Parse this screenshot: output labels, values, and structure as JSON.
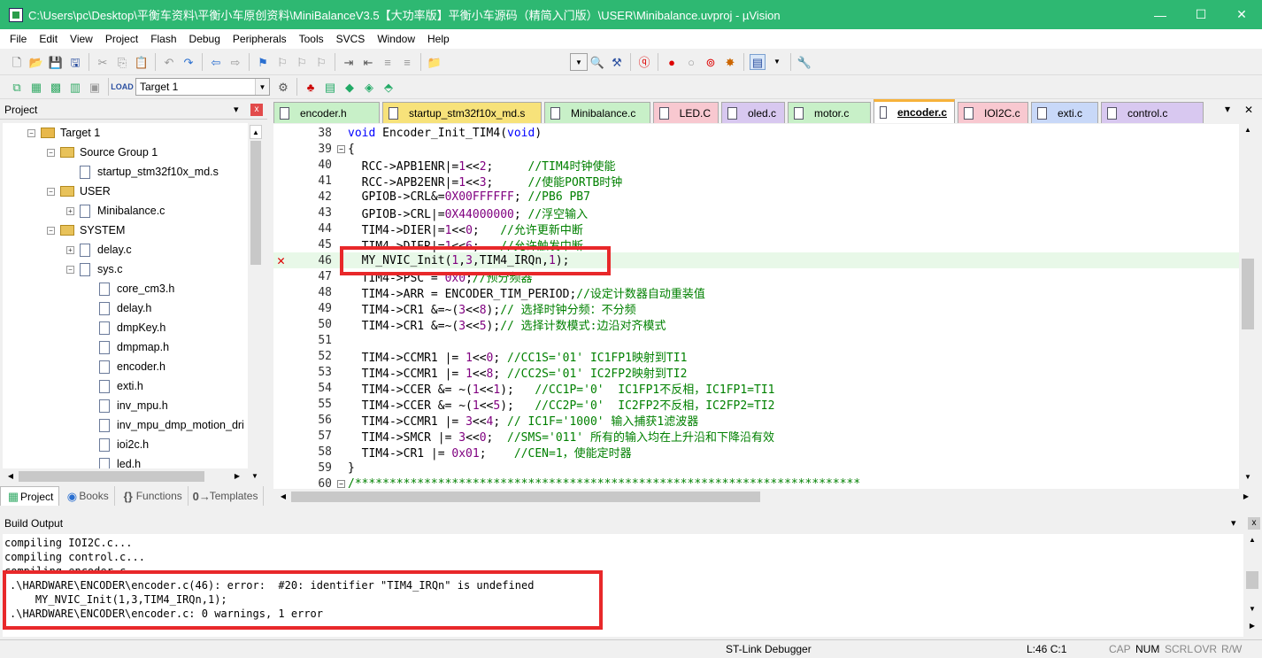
{
  "window": {
    "title": "C:\\Users\\pc\\Desktop\\平衡车资料\\平衡小车原创资料\\MiniBalanceV3.5【大功率版】平衡小车源码（精简入门版）\\USER\\Minibalance.uvproj - µVision",
    "min": "—",
    "max": "☐",
    "close": "✕"
  },
  "menu": [
    "File",
    "Edit",
    "View",
    "Project",
    "Flash",
    "Debug",
    "Peripherals",
    "Tools",
    "SVCS",
    "Window",
    "Help"
  ],
  "toolbar2": {
    "target": "Target 1"
  },
  "project": {
    "title": "Project",
    "pin": "▾",
    "close": "x",
    "tree": [
      {
        "label": "Target 1",
        "type": "target",
        "indent": 0,
        "pm": "−"
      },
      {
        "label": "Source Group 1",
        "type": "folder",
        "indent": 1,
        "pm": "−"
      },
      {
        "label": "startup_stm32f10x_md.s",
        "type": "file",
        "indent": 2,
        "pm": ""
      },
      {
        "label": "USER",
        "type": "folder",
        "indent": 1,
        "pm": "−"
      },
      {
        "label": "Minibalance.c",
        "type": "file",
        "indent": 2,
        "pm": "+"
      },
      {
        "label": "SYSTEM",
        "type": "folder",
        "indent": 1,
        "pm": "−"
      },
      {
        "label": "delay.c",
        "type": "file",
        "indent": 2,
        "pm": "+"
      },
      {
        "label": "sys.c",
        "type": "file",
        "indent": 2,
        "pm": "−"
      },
      {
        "label": "core_cm3.h",
        "type": "file",
        "indent": 3,
        "pm": ""
      },
      {
        "label": "delay.h",
        "type": "file",
        "indent": 3,
        "pm": ""
      },
      {
        "label": "dmpKey.h",
        "type": "file",
        "indent": 3,
        "pm": ""
      },
      {
        "label": "dmpmap.h",
        "type": "file",
        "indent": 3,
        "pm": ""
      },
      {
        "label": "encoder.h",
        "type": "file",
        "indent": 3,
        "pm": ""
      },
      {
        "label": "exti.h",
        "type": "file",
        "indent": 3,
        "pm": ""
      },
      {
        "label": "inv_mpu.h",
        "type": "file",
        "indent": 3,
        "pm": ""
      },
      {
        "label": "inv_mpu_dmp_motion_dri",
        "type": "file",
        "indent": 3,
        "pm": ""
      },
      {
        "label": "ioi2c.h",
        "type": "file",
        "indent": 3,
        "pm": ""
      },
      {
        "label": "led.h",
        "type": "file",
        "indent": 3,
        "pm": ""
      }
    ],
    "tabs": [
      "Project",
      "Books",
      "Functions",
      "Templates"
    ]
  },
  "filetabs": [
    {
      "label": "encoder.h",
      "color": "#c8f0c8",
      "active": false
    },
    {
      "label": "startup_stm32f10x_md.s",
      "color": "#f7e27a",
      "active": false
    },
    {
      "label": "Minibalance.c",
      "color": "#c8f0c8",
      "active": false
    },
    {
      "label": "LED.C",
      "color": "#f8c8d0",
      "active": false
    },
    {
      "label": "oled.c",
      "color": "#d8c8f0",
      "active": false
    },
    {
      "label": "motor.c",
      "color": "#c8f0c8",
      "active": false
    },
    {
      "label": "encoder.c",
      "color": "#f7d07a",
      "active": true
    },
    {
      "label": "IOI2C.c",
      "color": "#f8c8d0",
      "active": false
    },
    {
      "label": "exti.c",
      "color": "#c8d8f8",
      "active": false
    },
    {
      "label": "control.c",
      "color": "#d8c8f0",
      "active": false
    }
  ],
  "tabmenu": "▾",
  "tabclose": "✕",
  "code": [
    {
      "n": "38",
      "t": "void Encoder_Init_TIM4(void)"
    },
    {
      "n": "39",
      "t": "{"
    },
    {
      "n": "40",
      "t": "  RCC->APB1ENR|=1<<2;     //TIM4时钟使能"
    },
    {
      "n": "41",
      "t": "  RCC->APB2ENR|=1<<3;     //使能PORTB时钟"
    },
    {
      "n": "42",
      "t": "  GPIOB->CRL&=0X00FFFFFF; //PB6 PB7"
    },
    {
      "n": "43",
      "t": "  GPIOB->CRL|=0X44000000; //浮空输入"
    },
    {
      "n": "44",
      "t": "  TIM4->DIER|=1<<0;   //允许更新中断"
    },
    {
      "n": "45",
      "t": "  TIM4->DIER|=1<<6;   //允许触发中断"
    },
    {
      "n": "46",
      "t": "  MY_NVIC_Init(1,3,TIM4_IRQn,1);"
    },
    {
      "n": "47",
      "t": "  TIM4->PSC = 0x0;//预分频器"
    },
    {
      "n": "48",
      "t": "  TIM4->ARR = ENCODER_TIM_PERIOD;//设定计数器自动重装值"
    },
    {
      "n": "49",
      "t": "  TIM4->CR1 &=~(3<<8);// 选择时钟分频：不分频"
    },
    {
      "n": "50",
      "t": "  TIM4->CR1 &=~(3<<5);// 选择计数模式:边沿对齐模式"
    },
    {
      "n": "51",
      "t": ""
    },
    {
      "n": "52",
      "t": "  TIM4->CCMR1 |= 1<<0; //CC1S='01' IC1FP1映射到TI1"
    },
    {
      "n": "53",
      "t": "  TIM4->CCMR1 |= 1<<8; //CC2S='01' IC2FP2映射到TI2"
    },
    {
      "n": "54",
      "t": "  TIM4->CCER &= ~(1<<1);   //CC1P='0'  IC1FP1不反相，IC1FP1=TI1"
    },
    {
      "n": "55",
      "t": "  TIM4->CCER &= ~(1<<5);   //CC2P='0'  IC2FP2不反相，IC2FP2=TI2"
    },
    {
      "n": "56",
      "t": "  TIM4->CCMR1 |= 3<<4; // IC1F='1000' 输入捕获1滤波器"
    },
    {
      "n": "57",
      "t": "  TIM4->SMCR |= 3<<0;  //SMS='011' 所有的输入均在上升沿和下降沿有效"
    },
    {
      "n": "58",
      "t": "  TIM4->CR1 |= 0x01;    //CEN=1，使能定时器"
    },
    {
      "n": "59",
      "t": "}"
    },
    {
      "n": "60",
      "t": "/*************************************************************************"
    }
  ],
  "build": {
    "title": "Build Output",
    "lines": [
      "compiling IOI2C.c...",
      "compiling control.c...",
      "compiling encoder.c...",
      ".\\HARDWARE\\ENCODER\\encoder.c(46): error:  #20: identifier \"TIM4_IRQn\" is undefined",
      "    MY_NVIC_Init(1,3,TIM4_IRQn,1);",
      ".\\HARDWARE\\ENCODER\\encoder.c: 0 warnings, 1 error"
    ]
  },
  "status": {
    "debugger": "ST-Link Debugger",
    "pos": "L:46 C:1",
    "caps": "CAP",
    "num": "NUM",
    "scrl": "SCRL",
    "ovr": "OVR",
    "rw": "R/W"
  }
}
